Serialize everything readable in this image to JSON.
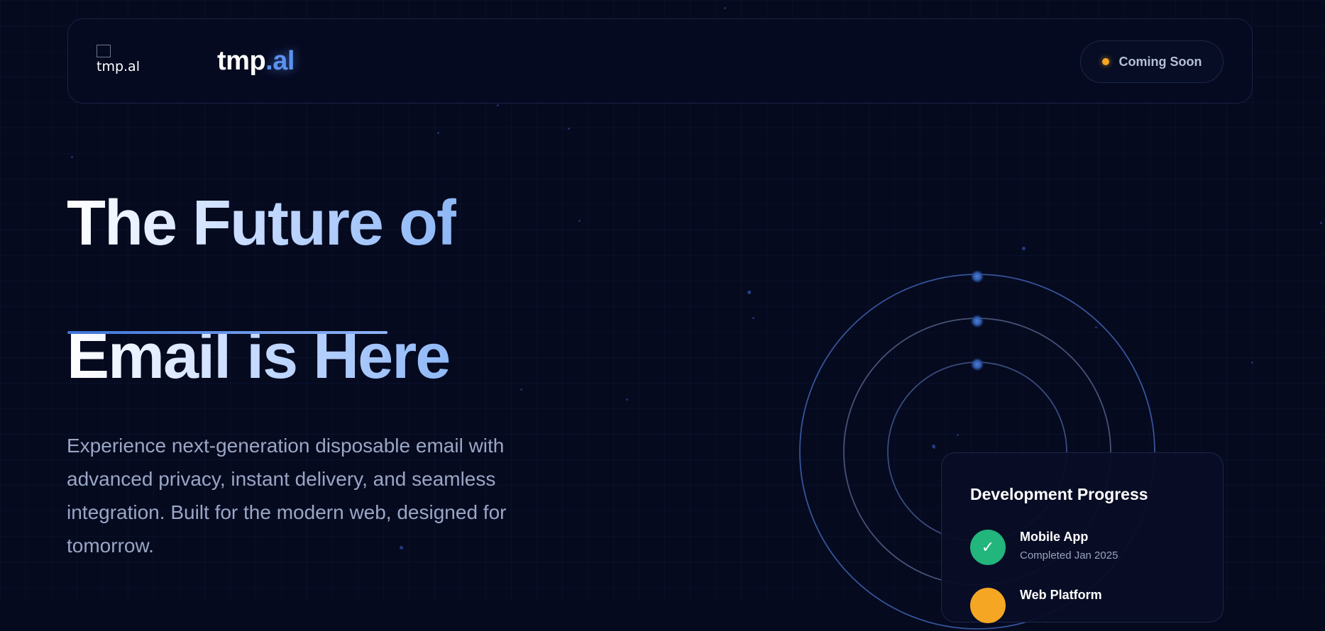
{
  "nav": {
    "logo_alt": "tmp.al",
    "brand_main": "tmp",
    "brand_accent": ".al",
    "status_badge": {
      "label": "Coming Soon",
      "dot_color": "#f5a623"
    }
  },
  "hero": {
    "title_line1": "The Future of",
    "title_line2": "Email is Here",
    "description": "Experience next-generation disposable email with advanced privacy, instant delivery, and seamless integration. Built for the modern web, designed for tomorrow."
  },
  "progress": {
    "title": "Development Progress",
    "milestones": [
      {
        "name": "Mobile App",
        "status": "Completed Jan 2025",
        "icon": "check-icon",
        "icon_glyph": "✓",
        "color": "#22b57c"
      },
      {
        "name": "Web Platform",
        "status": "",
        "icon": "in-progress-icon",
        "icon_glyph": "",
        "color": "#f5a623"
      }
    ]
  },
  "colors": {
    "background": "#050a1f",
    "accent_blue": "#5b92f0",
    "success_green": "#22b57c",
    "warning_orange": "#f5a623"
  }
}
